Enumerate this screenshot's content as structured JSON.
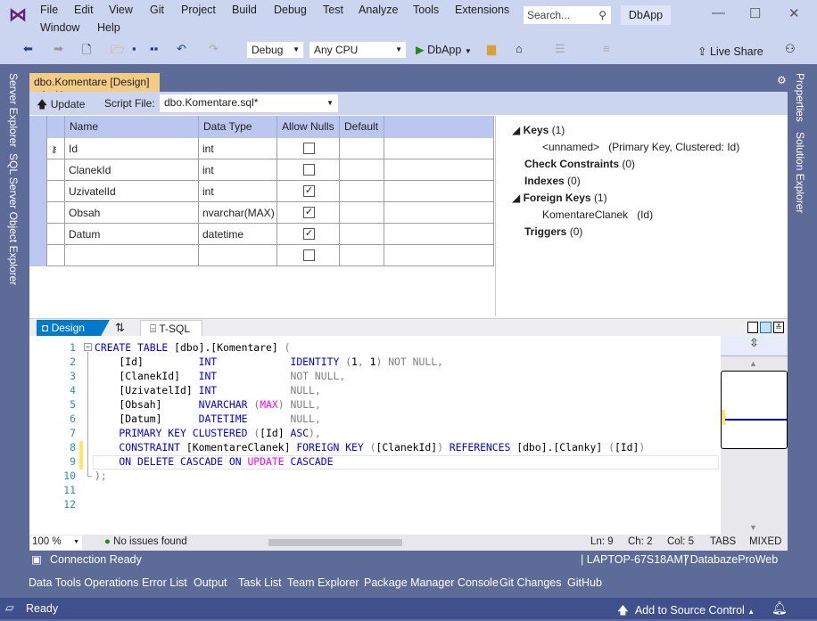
{
  "app": {
    "name": "DbApp",
    "search_placeholder": "Search...",
    "colors": {
      "chrome": "#ccd5f0",
      "frame": "#5d6b99",
      "accent_tab": "#f5cc84",
      "status": "#40508d",
      "keyword": "#0000ff"
    }
  },
  "menu": [
    "File",
    "Edit",
    "View",
    "Git",
    "Project",
    "Build",
    "Debug",
    "Test",
    "Analyze",
    "Tools",
    "Extensions",
    "Window",
    "Help"
  ],
  "toolbar": {
    "config": "Debug",
    "platform": "Any CPU",
    "run": "DbApp",
    "live_share": "Live Share"
  },
  "side_left": [
    "Server Explorer",
    "SQL Server Object Explorer"
  ],
  "side_right": [
    "Properties",
    "Solution Explorer"
  ],
  "doc_tab": {
    "title": "dbo.Komentare [Design]",
    "pin": "⊹",
    "close": "✕"
  },
  "designer_toolbar": {
    "update": "Update",
    "script_label": "Script File:",
    "script_value": "dbo.Komentare.sql*"
  },
  "grid": {
    "headers": [
      "Name",
      "Data Type",
      "Allow Nulls",
      "Default"
    ],
    "rows": [
      {
        "name": "Id",
        "type": "int",
        "nulls": false,
        "key": true
      },
      {
        "name": "ClanekId",
        "type": "int",
        "nulls": false
      },
      {
        "name": "UzivatelId",
        "type": "int",
        "nulls": true
      },
      {
        "name": "Obsah",
        "type": "nvarchar(MAX)",
        "nulls": true
      },
      {
        "name": "Datum",
        "type": "datetime",
        "nulls": true
      },
      {
        "name": "",
        "type": "",
        "nulls": false
      }
    ]
  },
  "keys_pane": {
    "keys": "Keys",
    "keys_count": "(1)",
    "pk_name": "<unnamed>",
    "pk_desc": "(Primary Key, Clustered: Id)",
    "check": "Check Constraints",
    "check_count": "(0)",
    "indexes": "Indexes",
    "indexes_count": "(0)",
    "fks": "Foreign Keys",
    "fks_count": "(1)",
    "fk_name": "KomentareClanek",
    "fk_desc": "(Id)",
    "triggers": "Triggers",
    "triggers_count": "(0)"
  },
  "bottom_tabs": {
    "design": "Design",
    "swap": "⇅",
    "tsql": "T-SQL"
  },
  "code": [
    [
      [
        "kw",
        "CREATE TABLE "
      ],
      [
        "tx",
        "[dbo].[Komentare] "
      ],
      [
        "gy",
        "("
      ]
    ],
    [
      [
        "tx",
        "    [Id]         "
      ],
      [
        "kw",
        "INT            IDENTITY "
      ],
      [
        "gy",
        "("
      ],
      [
        "tx",
        "1"
      ],
      [
        "gy",
        ", "
      ],
      [
        "tx",
        "1"
      ],
      [
        "gy",
        ") NOT NULL,"
      ]
    ],
    [
      [
        "tx",
        "    [ClanekId]   "
      ],
      [
        "kw",
        "INT            "
      ],
      [
        "gy",
        "NOT NULL,"
      ]
    ],
    [
      [
        "tx",
        "    [UzivatelId] "
      ],
      [
        "kw",
        "INT            "
      ],
      [
        "gy",
        "NULL,"
      ]
    ],
    [
      [
        "tx",
        "    [Obsah]      "
      ],
      [
        "kw",
        "NVARCHAR "
      ],
      [
        "gy",
        "("
      ],
      [
        "fn",
        "MAX"
      ],
      [
        "gy",
        ") NULL,"
      ]
    ],
    [
      [
        "tx",
        "    [Datum]      "
      ],
      [
        "kw",
        "DATETIME       "
      ],
      [
        "gy",
        "NULL,"
      ]
    ],
    [
      [
        "kw",
        "    PRIMARY KEY CLUSTERED "
      ],
      [
        "gy",
        "("
      ],
      [
        "tx",
        "[Id] "
      ],
      [
        "kw",
        "ASC"
      ],
      [
        "gy",
        "),"
      ]
    ],
    [
      [
        "kw",
        "    CONSTRAINT "
      ],
      [
        "tx",
        "[KomentareClanek] "
      ],
      [
        "kw",
        "FOREIGN KEY "
      ],
      [
        "gy",
        "("
      ],
      [
        "tx",
        "[ClanekId]"
      ],
      [
        "gy",
        ") "
      ],
      [
        "kw",
        "REFERENCES "
      ],
      [
        "tx",
        "[dbo].[Clanky] "
      ],
      [
        "gy",
        "("
      ],
      [
        "tx",
        "[Id]"
      ],
      [
        "gy",
        ")"
      ]
    ],
    [
      [
        "kw",
        "    ON DELETE CASCADE ON "
      ],
      [
        "fn",
        "UPDATE "
      ],
      [
        "kw",
        "CASCADE"
      ]
    ],
    [
      [
        "gy",
        ");"
      ]
    ],
    [],
    []
  ],
  "editor_status": {
    "zoom": "100 %",
    "issues": "No issues found",
    "ln": "Ln: 9",
    "ch": "Ch: 2",
    "col": "Col: 5",
    "tabs": "TABS",
    "eol": "MIXED"
  },
  "connection": {
    "status": "Connection Ready",
    "server": "LAPTOP-67S18AM7",
    "database": "DatabazeProWeb"
  },
  "tool_tabs": [
    "Data Tools Operations",
    "Error List",
    "Output",
    "Task List",
    "Team Explorer",
    "Package Manager Console",
    "Git Changes",
    "GitHub"
  ],
  "status_bar": {
    "ready": "Ready",
    "source_control": "Add to Source Control"
  }
}
